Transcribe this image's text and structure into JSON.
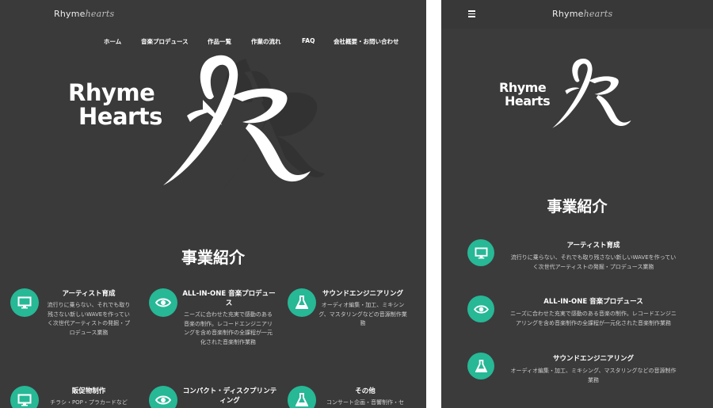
{
  "brand": {
    "part1": "Rhyme",
    "part2": "hearts"
  },
  "nav": [
    "ホーム",
    "音楽プロデュース",
    "作品一覧",
    "作業の流れ",
    "FAQ",
    "会社概要・お問い合わせ"
  ],
  "hero": {
    "line1": "Rhyme",
    "line2": "Hearts"
  },
  "section_title": "事業紹介",
  "services_desktop": [
    {
      "icon": "monitor-icon",
      "title": "アーティスト育成",
      "desc": "流行りに乗らない、それでも取り残さない新しいWAVEを作っていく次世代アーティストの発掘・プロデュース業務"
    },
    {
      "icon": "eye-icon",
      "title": "ALL-IN-ONE 音楽プロデュース",
      "desc": "ニーズに合わせた充実で感動のある音楽の制作。レコードエンジニアリングを含め音楽制作の全課程が一元化された音楽制作業務"
    },
    {
      "icon": "flask-icon",
      "title": "サウンドエンジニアリング",
      "desc": "オーディオ編集・加工、ミキシング、マスタリングなどの音源制作業務"
    },
    {
      "icon": "monitor-icon",
      "title": "販促物制作",
      "desc": "チラシ・POP・プラカードなど"
    },
    {
      "icon": "eye-icon",
      "title": "コンパクト・ディスクプリンティング",
      "desc": ""
    },
    {
      "icon": "flask-icon",
      "title": "その他",
      "desc": "コンサート企画・音響制作・セ"
    }
  ],
  "services_mobile": [
    {
      "icon": "monitor-icon",
      "title": "アーティスト育成",
      "desc_lines": [
        "流行りに乗らない、それでも取り残さない新しいWAVEを作ってい",
        "く次世代アーティストの発掘・プロデュース業務"
      ]
    },
    {
      "icon": "eye-icon",
      "title": "ALL-IN-ONE 音楽プロデュース",
      "desc_lines": [
        "ニーズに合わせた充実で感動のある音楽の制作。レコードエンジニ",
        "アリングを含め音楽制作の全課程が一元化された音楽制作業務"
      ]
    },
    {
      "icon": "flask-icon",
      "title": "サウンドエンジニアリング",
      "desc_lines": [
        "オーディオ編集・加工、ミキシング、マスタリングなどの音源制作",
        "業務"
      ]
    }
  ],
  "colors": {
    "accent": "#27b896",
    "background": "#3a3a3a",
    "header": "#383838"
  }
}
